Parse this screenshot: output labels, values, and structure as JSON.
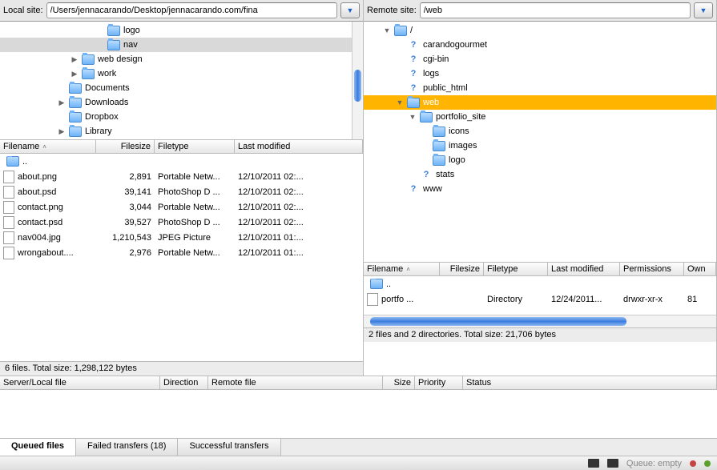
{
  "local": {
    "label": "Local site:",
    "path": "/Users/jennacarando/Desktop/jennacarando.com/fina",
    "tree": [
      {
        "indent": 7,
        "arrow": "",
        "icon": "folder",
        "label": "logo",
        "dim": false
      },
      {
        "indent": 7,
        "arrow": "",
        "icon": "folder",
        "label": "nav",
        "dim": true
      },
      {
        "indent": 5,
        "arrow": "closed",
        "icon": "folder",
        "label": "web design",
        "dim": false
      },
      {
        "indent": 5,
        "arrow": "closed",
        "icon": "folder",
        "label": "work",
        "dim": false
      },
      {
        "indent": 4,
        "arrow": "",
        "icon": "folder",
        "label": "Documents",
        "dim": false
      },
      {
        "indent": 4,
        "arrow": "closed",
        "icon": "folder",
        "label": "Downloads",
        "dim": false
      },
      {
        "indent": 4,
        "arrow": "",
        "icon": "folder",
        "label": "Dropbox",
        "dim": false
      },
      {
        "indent": 4,
        "arrow": "closed",
        "icon": "folder",
        "label": "Library",
        "dim": false
      }
    ],
    "cols": {
      "filename": "Filename",
      "filesize": "Filesize",
      "filetype": "Filetype",
      "lastmod": "Last modified"
    },
    "parent": "..",
    "files": [
      {
        "name": "about.png",
        "size": "2,891",
        "type": "Portable Netw...",
        "mod": "12/10/2011 02:..."
      },
      {
        "name": "about.psd",
        "size": "39,141",
        "type": "PhotoShop D ...",
        "mod": "12/10/2011 02:..."
      },
      {
        "name": "contact.png",
        "size": "3,044",
        "type": "Portable Netw...",
        "mod": "12/10/2011 02:..."
      },
      {
        "name": "contact.psd",
        "size": "39,527",
        "type": "PhotoShop D ...",
        "mod": "12/10/2011 02:..."
      },
      {
        "name": "nav004.jpg",
        "size": "1,210,543",
        "type": "JPEG Picture",
        "mod": "12/10/2011 01:..."
      },
      {
        "name": "wrongabout....",
        "size": "2,976",
        "type": "Portable Netw...",
        "mod": "12/10/2011 01:..."
      }
    ],
    "status": "6 files. Total size: 1,298,122 bytes"
  },
  "remote": {
    "label": "Remote site:",
    "path": "/web",
    "tree": [
      {
        "indent": 1,
        "arrow": "open",
        "icon": "folder",
        "label": "/",
        "sel": false
      },
      {
        "indent": 2,
        "arrow": "",
        "icon": "q",
        "label": "carandogourmet",
        "sel": false
      },
      {
        "indent": 2,
        "arrow": "",
        "icon": "q",
        "label": "cgi-bin",
        "sel": false
      },
      {
        "indent": 2,
        "arrow": "",
        "icon": "q",
        "label": "logs",
        "sel": false
      },
      {
        "indent": 2,
        "arrow": "",
        "icon": "q",
        "label": "public_html",
        "sel": false
      },
      {
        "indent": 2,
        "arrow": "open",
        "icon": "folder",
        "label": "web",
        "sel": true
      },
      {
        "indent": 3,
        "arrow": "open",
        "icon": "folder",
        "label": "portfolio_site",
        "sel": false
      },
      {
        "indent": 4,
        "arrow": "",
        "icon": "folder",
        "label": "icons",
        "sel": false
      },
      {
        "indent": 4,
        "arrow": "",
        "icon": "folder",
        "label": "images",
        "sel": false
      },
      {
        "indent": 4,
        "arrow": "",
        "icon": "folder",
        "label": "logo",
        "sel": false
      },
      {
        "indent": 3,
        "arrow": "",
        "icon": "q",
        "label": "stats",
        "sel": false
      },
      {
        "indent": 2,
        "arrow": "",
        "icon": "q",
        "label": "www",
        "sel": false
      }
    ],
    "cols": {
      "filename": "Filename",
      "filesize": "Filesize",
      "filetype": "Filetype",
      "lastmod": "Last modified",
      "perms": "Permissions",
      "owner": "Own"
    },
    "parent": "..",
    "files": [
      {
        "name": "portfo ...",
        "size": "",
        "type": "Directory",
        "mod": "12/24/2011...",
        "perms": "drwxr-xr-x",
        "owner": "81"
      }
    ],
    "status": "2 files and 2 directories. Total size: 21,706 bytes"
  },
  "transfer": {
    "cols": {
      "server": "Server/Local file",
      "dir": "Direction",
      "remote": "Remote file",
      "size": "Size",
      "prio": "Priority",
      "status": "Status"
    }
  },
  "tabs": {
    "queued": "Queued files",
    "failed": "Failed transfers (18)",
    "success": "Successful transfers"
  },
  "footer": {
    "queue": "Queue: empty"
  }
}
